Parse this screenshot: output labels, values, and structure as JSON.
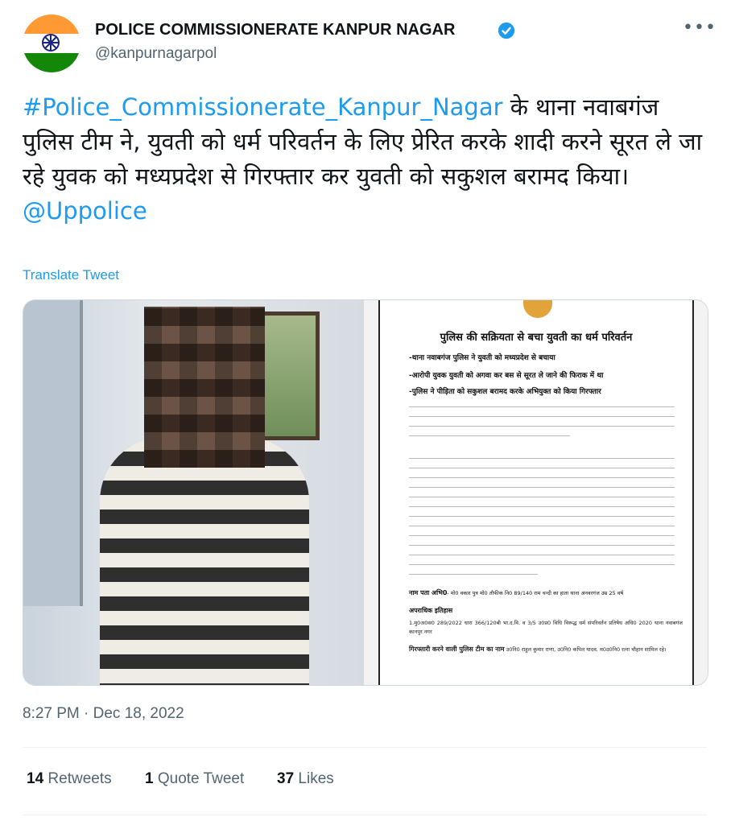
{
  "account": {
    "display_name": "POLICE COMMISSIONERATE KANPUR NAGAR",
    "handle": "@kanpurnagarpol",
    "verified": true,
    "avatar_icon": "india-flag-avatar"
  },
  "tweet": {
    "hashtag": "#Police_Commissionerate_Kanpur_Nagar",
    "text": " के  थाना नवाबगंज पुलिस टीम ने, युवती को धर्म परिवर्तन के लिए प्रेरित करके शादी करने सूरत ले जा रहे युवक को मध्यप्रदेश से गिरफ्तार कर युवती को सकुशल बरामद किया।",
    "mention": "@Uppolice",
    "translate_label": "Translate Tweet",
    "timestamp": "8:27 PM · Dec 18, 2022"
  },
  "document": {
    "title": "पुलिस की सक्रियता से बचा युवती का धर्म परिवर्तन",
    "bullets": [
      "-थाना नवाबगंज पुलिस ने युवती को मध्यप्रदेश से बचाया",
      "-आरोपी युवक युवती को अगवा कर बस से सूरत ले जाने की फिराक में था",
      "-पुलिस ने पीड़िता को सकुशल बरामद  करके अभियुक्त को किया गिरफ्तार"
    ],
    "heading_address": "नाम पता अभि0",
    "address_text": "- मो0 वकार पुत्र मो0 तौफीक नि0 89/140 राम चन्दी का हाता थाना अनवरगंज उम्र 25 वर्ष",
    "heading_history": "अपराधिक इतिहास",
    "history_text": "1.मु0अ0स0 289/2022 धारा 366/120बी भा.द.वि. व 3/5 उ0प्र0 विधि विरूद्ध धर्म संपरिवर्तन प्रतिषेध अधि0 2020 थाना नवाबगंज कानपुर नगर",
    "heading_team": "गिरफ्तारी करने वाली पुलिस टीम का नाम",
    "team_text": "उ0नि0 राहुल कुमार राणा, उ0नि0 कपिल यादव, म0उ0नि0 रत्ना चौहान शामिल रहे।"
  },
  "stats": {
    "retweets_count": "14",
    "retweets_label": "Retweets",
    "quotes_count": "1",
    "quotes_label": "Quote Tweet",
    "likes_count": "37",
    "likes_label": "Likes"
  },
  "colors": {
    "link": "#1d9bf0",
    "secondary_text": "#536471",
    "primary_text": "#0f1419"
  }
}
